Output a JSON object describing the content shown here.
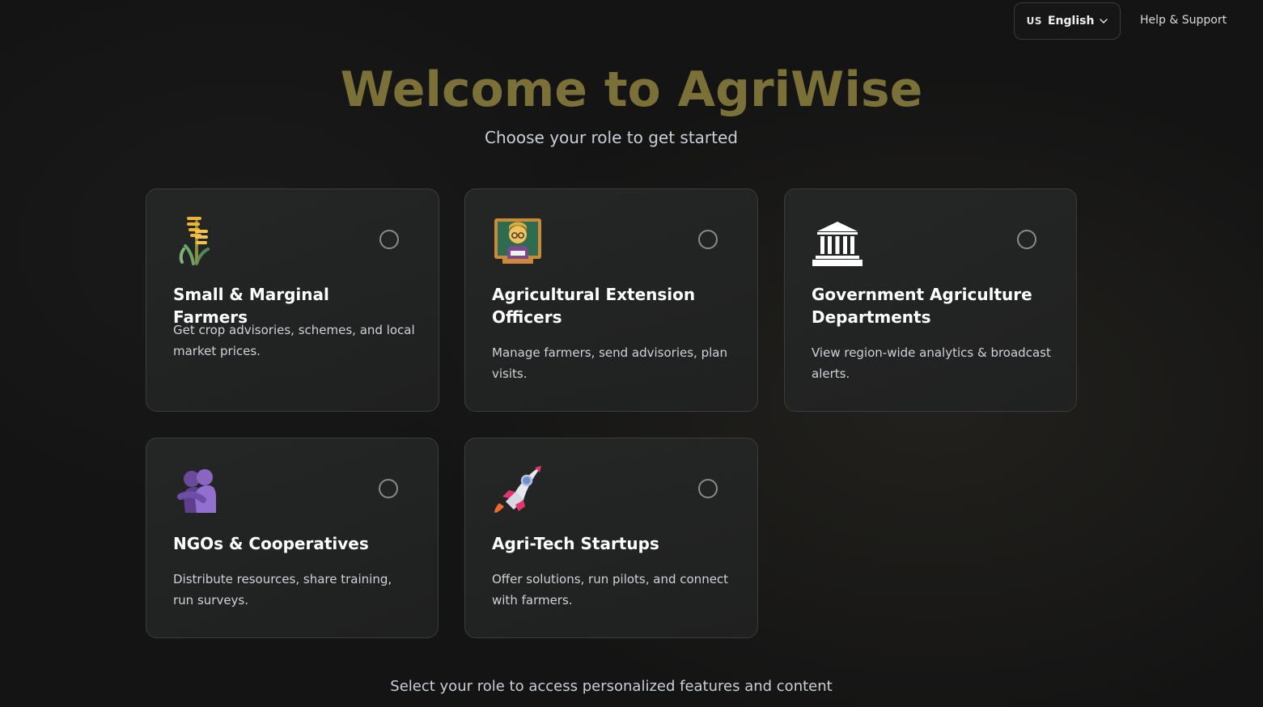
{
  "header": {
    "language_code": "US",
    "language_label": "English",
    "help_label": "Help & Support"
  },
  "hero": {
    "title": "Welcome to AgriWise",
    "subtitle": "Choose your role to get started"
  },
  "roles": [
    {
      "title": "Small & Marginal Farmers",
      "description": "Get crop advisories, schemes, and local market prices.",
      "icon": "sheaf-of-rice-icon"
    },
    {
      "title": "Agricultural Extension Officers",
      "description": "Manage farmers, send advisories, plan visits.",
      "icon": "teacher-icon"
    },
    {
      "title": "Government Agriculture Departments",
      "description": "View region-wide analytics & broadcast alerts.",
      "icon": "classical-building-icon"
    },
    {
      "title": "NGOs & Cooperatives",
      "description": "Distribute resources, share training, run surveys.",
      "icon": "people-hugging-icon"
    },
    {
      "title": "Agri-Tech Startups",
      "description": "Offer solutions, run pilots, and connect with farmers.",
      "icon": "rocket-icon"
    }
  ],
  "footer": {
    "note": "Select your role to access personalized features and content"
  },
  "colors": {
    "background": "#141414",
    "title": "#7b7038",
    "card_border": "#3c3c3c"
  }
}
